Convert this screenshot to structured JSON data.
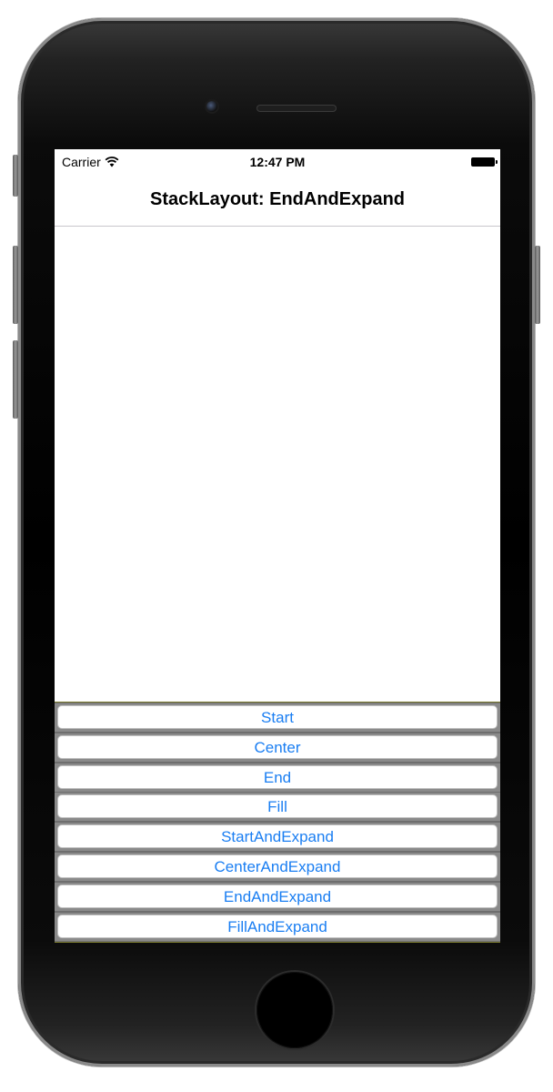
{
  "status_bar": {
    "carrier": "Carrier",
    "time": "12:47 PM",
    "wifi_icon": "wifi-icon",
    "battery_icon": "battery-icon"
  },
  "nav": {
    "title": "StackLayout: EndAndExpand"
  },
  "buttons": [
    {
      "label": "Start"
    },
    {
      "label": "Center"
    },
    {
      "label": "End"
    },
    {
      "label": "Fill"
    },
    {
      "label": "StartAndExpand"
    },
    {
      "label": "CenterAndExpand"
    },
    {
      "label": "EndAndExpand"
    },
    {
      "label": "FillAndExpand"
    }
  ],
  "colors": {
    "button_text": "#1a7ef2",
    "separator": "#f0f035",
    "item_background": "#8a8a8a"
  }
}
